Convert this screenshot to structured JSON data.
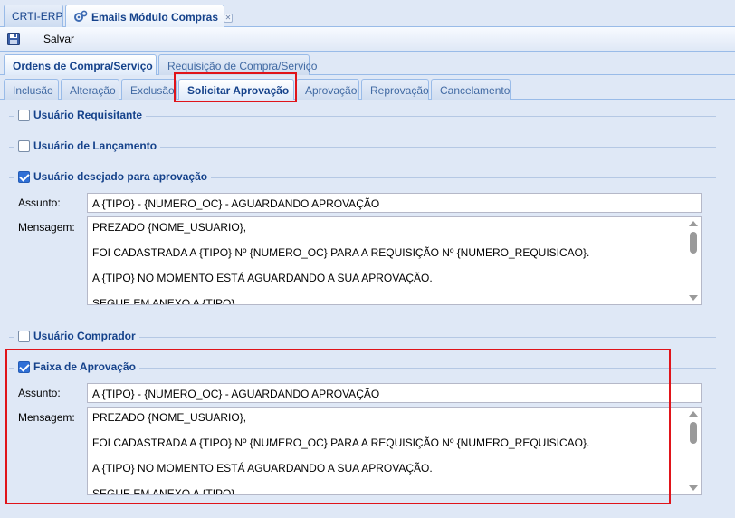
{
  "top_tabs": [
    {
      "label": "CRTI-ERP"
    },
    {
      "label": "Emails Módulo Compras"
    }
  ],
  "toolbar": {
    "save_label": "Salvar"
  },
  "main_tabs": [
    {
      "label": "Ordens de Compra/Serviço"
    },
    {
      "label": "Requisição de Compra/Serviço"
    }
  ],
  "sub_tabs": [
    {
      "label": "Inclusão"
    },
    {
      "label": "Alteração"
    },
    {
      "label": "Exclusão"
    },
    {
      "label": "Solicitar Aprovação"
    },
    {
      "label": "Aprovação"
    },
    {
      "label": "Reprovação"
    },
    {
      "label": "Cancelamento"
    }
  ],
  "sections": {
    "requisitante": {
      "label": "Usuário Requisitante",
      "checked": false
    },
    "lancamento": {
      "label": "Usuário de Lançamento",
      "checked": false
    },
    "desejado": {
      "label": "Usuário desejado para aprovação",
      "checked": true,
      "assunto_label": "Assunto:",
      "assunto_value": "A {TIPO} - {NUMERO_OC} - AGUARDANDO APROVAÇÃO",
      "mensagem_label": "Mensagem:",
      "mensagem_lines": [
        "PREZADO {NOME_USUARIO},",
        "FOI CADASTRADA A {TIPO} Nº {NUMERO_OC} PARA A REQUISIÇÃO Nº {NUMERO_REQUISICAO}.",
        "A {TIPO} NO MOMENTO ESTÁ AGUARDANDO A SUA APROVAÇÃO.",
        "SEGUE EM ANEXO A {TIPO}."
      ]
    },
    "comprador": {
      "label": "Usuário Comprador",
      "checked": false
    },
    "faixa": {
      "label": "Faixa de Aprovação",
      "checked": true,
      "assunto_label": "Assunto:",
      "assunto_value": "A {TIPO} - {NUMERO_OC} - AGUARDANDO APROVAÇÃO",
      "mensagem_label": "Mensagem:",
      "mensagem_lines": [
        "PREZADO {NOME_USUARIO},",
        "FOI CADASTRADA A {TIPO} Nº {NUMERO_OC} PARA A REQUISIÇÃO Nº {NUMERO_REQUISICAO}.",
        "A {TIPO} NO MOMENTO ESTÁ AGUARDANDO A SUA APROVAÇÃO.",
        "SEGUE EM ANEXO A {TIPO}."
      ]
    }
  },
  "colors": {
    "highlight": "#e0141a",
    "accent": "#15428b",
    "background": "#dfe8f6"
  }
}
